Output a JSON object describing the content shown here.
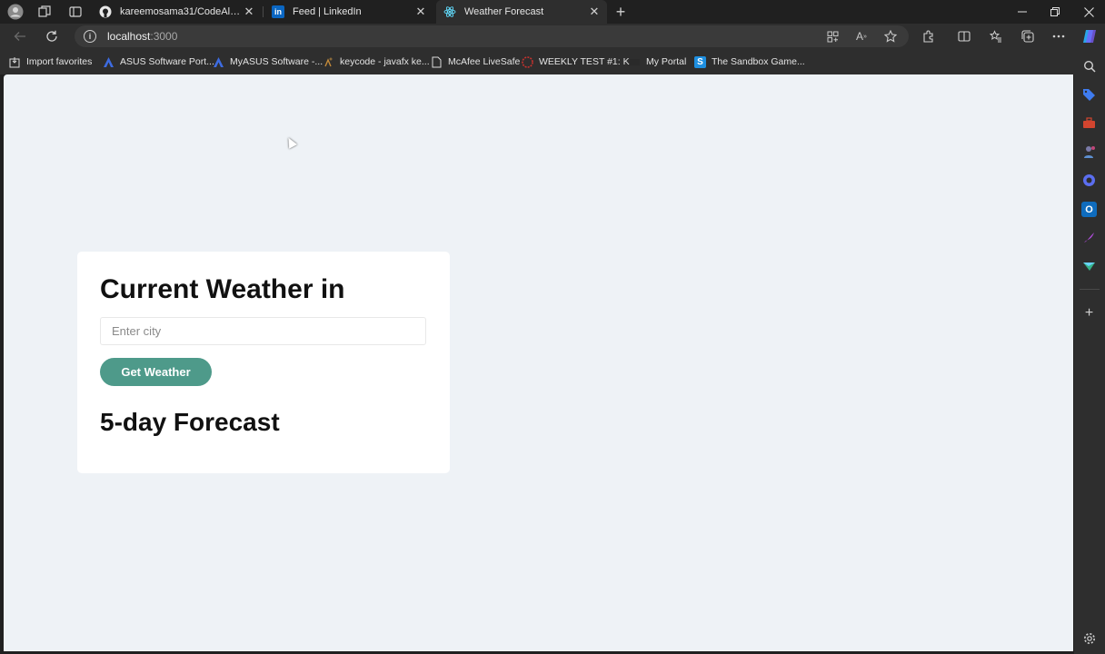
{
  "browser": {
    "tabs": [
      {
        "title": "kareemosama31/CodeAlpha_We",
        "icon": "github-icon",
        "active": false
      },
      {
        "title": "Feed | LinkedIn",
        "icon": "linkedin-icon",
        "active": false
      },
      {
        "title": "Weather Forecast",
        "icon": "react-icon",
        "active": true
      }
    ],
    "new_tab_symbol": "+",
    "url_host": "localhost",
    "url_port": ":3000",
    "bookmarks": [
      {
        "label": "Import favorites",
        "icon": "import-icon"
      },
      {
        "label": "ASUS Software Port...",
        "icon": "asus-icon"
      },
      {
        "label": "MyASUS Software -...",
        "icon": "asus-icon"
      },
      {
        "label": "keycode - javafx ke...",
        "icon": "keycode-icon"
      },
      {
        "label": "McAfee LiveSafe",
        "icon": "page-icon"
      },
      {
        "label": "WEEKLY TEST #1: K...",
        "icon": "badge-icon"
      },
      {
        "label": "My Portal",
        "icon": "portal-icon"
      },
      {
        "label": "The Sandbox Game...",
        "icon": "sandbox-icon"
      }
    ]
  },
  "page": {
    "heading": "Current Weather in",
    "city_placeholder": "Enter city",
    "city_value": "",
    "button_label": "Get Weather",
    "forecast_heading": "5-day Forecast"
  },
  "colors": {
    "page_bg": "#eef2f6",
    "card_bg": "#ffffff",
    "button_bg": "#4e9a8a",
    "chrome_bg": "#2e2e2e"
  }
}
